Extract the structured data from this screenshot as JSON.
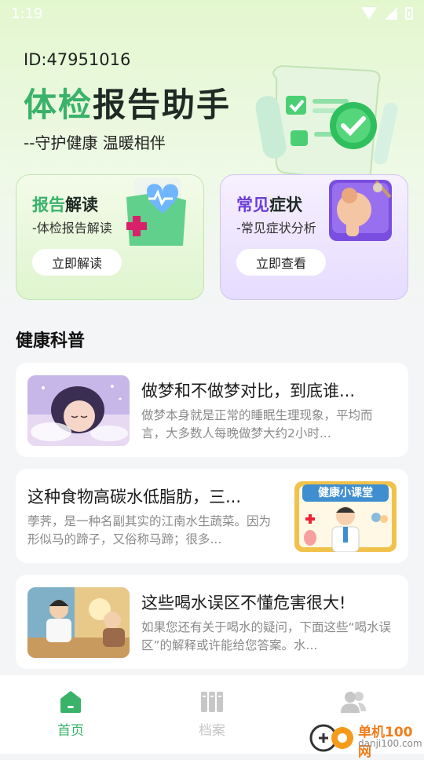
{
  "status_bar": {
    "time": "1:19"
  },
  "header": {
    "user_id": "ID:47951016",
    "title_part1": "体检",
    "title_part2": "报告助手",
    "slogan": "--守护健康 温暖相伴"
  },
  "cards": [
    {
      "title_part1": "报告",
      "title_part2": "解读",
      "subtitle": "-体检报告解读",
      "button": "立即解读"
    },
    {
      "title_part1": "常见",
      "title_part2": "症状",
      "subtitle": "-常见症状分析",
      "button": "立即查看"
    }
  ],
  "section": {
    "title": "健康科普"
  },
  "articles": [
    {
      "title": "做梦和不做梦对比，到底谁...",
      "desc": "做梦本身就是正常的睡眠生理现象，平均而言，大多数人每晚做梦大约2小时..."
    },
    {
      "title": "这种食物高碳水低脂肪，三...",
      "desc": "荸荠，是一种名副其实的江南水生蔬菜。因为形似马的蹄子，又俗称马蹄；很多...",
      "image_caption": "健康小课堂"
    },
    {
      "title": "这些喝水误区不懂危害很大!",
      "desc": "如果您还有关于喝水的疑问，下面这些“喝水误区”的解释或许能给您答案。水..."
    }
  ],
  "nav": [
    {
      "label": "首页",
      "icon": "home-icon",
      "active": true
    },
    {
      "label": "档案",
      "icon": "archive-icon",
      "active": false
    },
    {
      "label": "",
      "icon": "user-group-icon",
      "active": false
    }
  ],
  "watermark": {
    "line1": "单机100网",
    "line2": "danji100.com"
  },
  "colors": {
    "accent_green": "#39b26a",
    "accent_purple": "#6b3fd6",
    "inactive_gray": "#c7c7c7"
  }
}
